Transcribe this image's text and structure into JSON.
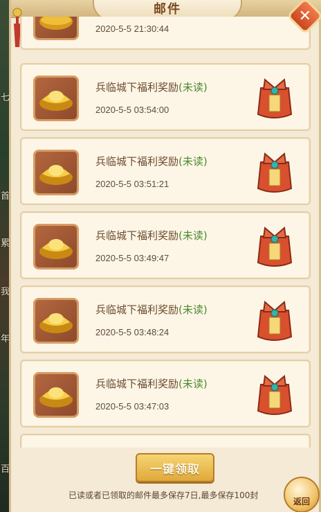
{
  "window": {
    "title": "邮件"
  },
  "side_text": [
    "七",
    "首",
    "累",
    "我",
    "年",
    "百"
  ],
  "mails": [
    {
      "title": "",
      "unread": "",
      "time": "2020-5-5 21:30:44"
    },
    {
      "title": "兵临城下福利奖励",
      "unread": "(未读)",
      "time": "2020-5-5 03:54:00"
    },
    {
      "title": "兵临城下福利奖励",
      "unread": "(未读)",
      "time": "2020-5-5 03:51:21"
    },
    {
      "title": "兵临城下福利奖励",
      "unread": "(未读)",
      "time": "2020-5-5 03:49:47"
    },
    {
      "title": "兵临城下福利奖励",
      "unread": "(未读)",
      "time": "2020-5-5 03:48:24"
    },
    {
      "title": "兵临城下福利奖励",
      "unread": "(未读)",
      "time": "2020-5-5 03:47:03"
    }
  ],
  "footer": {
    "claim_all": "一键领取",
    "note": "已读或者已领取的邮件最多保存7日,最多保存100封",
    "back": "返回"
  },
  "colors": {
    "unread": "#4a8a2a",
    "title": "#6b4a2c",
    "accent": "#c9461f"
  },
  "icons": {
    "reward": "gold-ingot-icon",
    "attachment": "gift-bag-icon",
    "close": "close-icon",
    "back": "back-arrow-icon"
  }
}
